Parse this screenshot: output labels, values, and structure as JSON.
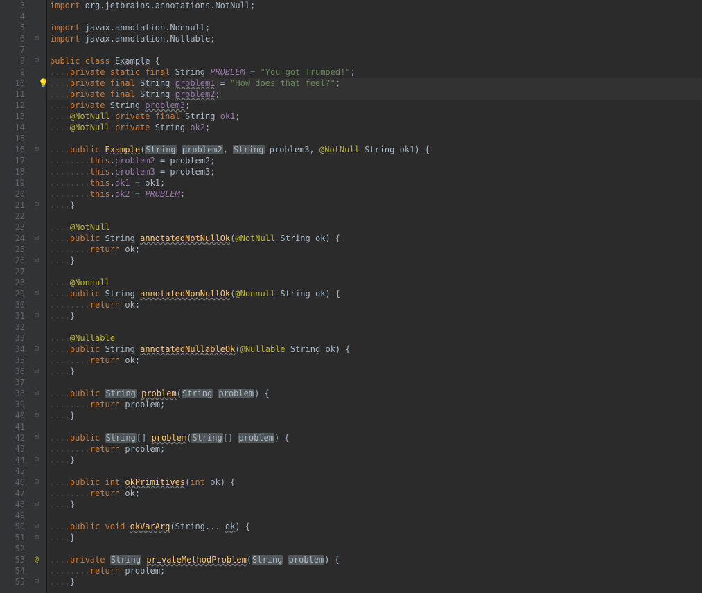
{
  "lines": [
    {
      "n": 3,
      "icon": "",
      "code": [
        [
          "kw",
          "import"
        ],
        [
          "",
          " "
        ],
        [
          "pkg",
          "org.jetbrains.annotations."
        ],
        [
          "cls",
          "NotNull"
        ],
        [
          "",
          ";"
        ]
      ]
    },
    {
      "n": 4,
      "icon": "",
      "code": []
    },
    {
      "n": 5,
      "icon": "",
      "code": [
        [
          "kw",
          "import"
        ],
        [
          "",
          " "
        ],
        [
          "pkg",
          "javax.annotation."
        ],
        [
          "cls",
          "Nonnull"
        ],
        [
          "",
          ";"
        ]
      ]
    },
    {
      "n": 6,
      "icon": "⊟",
      "code": [
        [
          "kw",
          "import"
        ],
        [
          "",
          " "
        ],
        [
          "pkg",
          "javax.annotation."
        ],
        [
          "cls",
          "Nullable"
        ],
        [
          "",
          ";"
        ]
      ]
    },
    {
      "n": 7,
      "icon": "",
      "code": []
    },
    {
      "n": 8,
      "icon": "⊟",
      "code": [
        [
          "kw",
          "public class"
        ],
        [
          "",
          " "
        ],
        [
          "underline",
          "Example"
        ],
        [
          "",
          " {"
        ]
      ]
    },
    {
      "n": 9,
      "icon": "",
      "indent": 1,
      "code": [
        [
          "kw",
          "private static final"
        ],
        [
          "",
          " "
        ],
        [
          "cls",
          "String"
        ],
        [
          "",
          " "
        ],
        [
          "const",
          "PROBLEM"
        ],
        [
          "",
          " = "
        ],
        [
          "str",
          "\"You got Trumped!\""
        ],
        [
          "",
          ";"
        ]
      ]
    },
    {
      "n": 10,
      "icon": "bulb",
      "indent": 1,
      "hl": true,
      "code": [
        [
          "kw",
          "private final"
        ],
        [
          "",
          " "
        ],
        [
          "cls",
          "String"
        ],
        [
          "",
          " "
        ],
        [
          "mbr underline-squig",
          "problem1"
        ],
        [
          "",
          " = "
        ],
        [
          "str",
          "\"How does that feel?\""
        ],
        [
          "",
          ";"
        ]
      ]
    },
    {
      "n": 11,
      "icon": "",
      "indent": 1,
      "hl": true,
      "code": [
        [
          "kw",
          "private final"
        ],
        [
          "",
          " "
        ],
        [
          "cls",
          "String"
        ],
        [
          "",
          " "
        ],
        [
          "mbr underline-squig",
          "problem2"
        ],
        [
          "",
          ";"
        ]
      ]
    },
    {
      "n": 12,
      "icon": "",
      "indent": 1,
      "code": [
        [
          "kw",
          "private"
        ],
        [
          "",
          " "
        ],
        [
          "cls",
          "String"
        ],
        [
          "",
          " "
        ],
        [
          "mbr underline-squig",
          "problem3"
        ],
        [
          "",
          ";"
        ]
      ]
    },
    {
      "n": 13,
      "icon": "",
      "indent": 1,
      "code": [
        [
          "ann",
          "@NotNull"
        ],
        [
          "",
          " "
        ],
        [
          "kw",
          "private final"
        ],
        [
          "",
          " "
        ],
        [
          "cls",
          "String"
        ],
        [
          "",
          " "
        ],
        [
          "mbr",
          "ok1"
        ],
        [
          "",
          ";"
        ]
      ]
    },
    {
      "n": 14,
      "icon": "",
      "indent": 1,
      "code": [
        [
          "ann",
          "@NotNull"
        ],
        [
          "",
          " "
        ],
        [
          "kw",
          "private"
        ],
        [
          "",
          " "
        ],
        [
          "cls",
          "String"
        ],
        [
          "",
          " "
        ],
        [
          "mbr",
          "ok2"
        ],
        [
          "",
          ";"
        ]
      ]
    },
    {
      "n": 15,
      "icon": "",
      "code": []
    },
    {
      "n": 16,
      "icon": "⊟",
      "indent": 1,
      "code": [
        [
          "kw",
          "public"
        ],
        [
          "",
          " "
        ],
        [
          "meth underline",
          "Example"
        ],
        [
          "",
          "("
        ],
        [
          "cls box",
          "String"
        ],
        [
          "",
          " "
        ],
        [
          "param box",
          "problem2"
        ],
        [
          "",
          ", "
        ],
        [
          "cls box",
          "String"
        ],
        [
          "",
          " "
        ],
        [
          "param",
          "problem3"
        ],
        [
          "",
          ", "
        ],
        [
          "ann",
          "@NotNull"
        ],
        [
          "",
          " "
        ],
        [
          "cls",
          "String"
        ],
        [
          "",
          " "
        ],
        [
          "param",
          "ok1"
        ],
        [
          "",
          ") {"
        ]
      ]
    },
    {
      "n": 17,
      "icon": "",
      "indent": 2,
      "code": [
        [
          "kw",
          "this"
        ],
        [
          "",
          "."
        ],
        [
          "mbr",
          "problem2"
        ],
        [
          "",
          " = problem2;"
        ]
      ]
    },
    {
      "n": 18,
      "icon": "",
      "indent": 2,
      "code": [
        [
          "kw",
          "this"
        ],
        [
          "",
          "."
        ],
        [
          "mbr",
          "problem3"
        ],
        [
          "",
          " = problem3;"
        ]
      ]
    },
    {
      "n": 19,
      "icon": "",
      "indent": 2,
      "code": [
        [
          "kw",
          "this"
        ],
        [
          "",
          "."
        ],
        [
          "mbr",
          "ok1"
        ],
        [
          "",
          " = ok1;"
        ]
      ]
    },
    {
      "n": 20,
      "icon": "",
      "indent": 2,
      "code": [
        [
          "kw",
          "this"
        ],
        [
          "",
          "."
        ],
        [
          "mbr",
          "ok2"
        ],
        [
          "",
          " = "
        ],
        [
          "const",
          "PROBLEM"
        ],
        [
          "",
          ";"
        ]
      ]
    },
    {
      "n": 21,
      "icon": "⊟",
      "indent": 1,
      "closer": true,
      "code": [
        [
          "",
          "}"
        ]
      ]
    },
    {
      "n": 22,
      "icon": "",
      "code": []
    },
    {
      "n": 23,
      "icon": "",
      "indent": 1,
      "code": [
        [
          "ann",
          "@NotNull"
        ]
      ]
    },
    {
      "n": 24,
      "icon": "⊟",
      "indent": 1,
      "code": [
        [
          "kw",
          "public"
        ],
        [
          "",
          " "
        ],
        [
          "cls",
          "String"
        ],
        [
          "",
          " "
        ],
        [
          "meth underline-squig",
          "annotatedNotNullOk"
        ],
        [
          "",
          "("
        ],
        [
          "ann",
          "@NotNull"
        ],
        [
          "",
          " "
        ],
        [
          "cls",
          "String"
        ],
        [
          "",
          " "
        ],
        [
          "param",
          "ok"
        ],
        [
          "",
          ") {"
        ]
      ]
    },
    {
      "n": 25,
      "icon": "",
      "indent": 2,
      "code": [
        [
          "kw",
          "return"
        ],
        [
          "",
          " ok;"
        ]
      ]
    },
    {
      "n": 26,
      "icon": "⊟",
      "indent": 1,
      "closer": true,
      "code": [
        [
          "",
          "}"
        ]
      ]
    },
    {
      "n": 27,
      "icon": "",
      "code": []
    },
    {
      "n": 28,
      "icon": "",
      "indent": 1,
      "code": [
        [
          "ann",
          "@Nonnull"
        ]
      ]
    },
    {
      "n": 29,
      "icon": "⊟",
      "indent": 1,
      "code": [
        [
          "kw",
          "public"
        ],
        [
          "",
          " "
        ],
        [
          "cls",
          "String"
        ],
        [
          "",
          " "
        ],
        [
          "meth underline-squig",
          "annotatedNonNullOk"
        ],
        [
          "",
          "("
        ],
        [
          "ann",
          "@Nonnull"
        ],
        [
          "",
          " "
        ],
        [
          "cls",
          "String"
        ],
        [
          "",
          " "
        ],
        [
          "param",
          "ok"
        ],
        [
          "",
          ") {"
        ]
      ]
    },
    {
      "n": 30,
      "icon": "",
      "indent": 2,
      "code": [
        [
          "kw",
          "return"
        ],
        [
          "",
          " ok;"
        ]
      ]
    },
    {
      "n": 31,
      "icon": "⊟",
      "indent": 1,
      "closer": true,
      "code": [
        [
          "",
          "}"
        ]
      ]
    },
    {
      "n": 32,
      "icon": "",
      "code": []
    },
    {
      "n": 33,
      "icon": "",
      "indent": 1,
      "code": [
        [
          "ann",
          "@Nullable"
        ]
      ]
    },
    {
      "n": 34,
      "icon": "⊟",
      "indent": 1,
      "code": [
        [
          "kw",
          "public"
        ],
        [
          "",
          " "
        ],
        [
          "cls",
          "String"
        ],
        [
          "",
          " "
        ],
        [
          "meth underline-squig",
          "annotatedNullableOk"
        ],
        [
          "",
          "("
        ],
        [
          "ann",
          "@Nullable"
        ],
        [
          "",
          " "
        ],
        [
          "cls",
          "String"
        ],
        [
          "",
          " "
        ],
        [
          "param",
          "ok"
        ],
        [
          "",
          ") {"
        ]
      ]
    },
    {
      "n": 35,
      "icon": "",
      "indent": 2,
      "code": [
        [
          "kw",
          "return"
        ],
        [
          "",
          " ok;"
        ]
      ]
    },
    {
      "n": 36,
      "icon": "⊟",
      "indent": 1,
      "closer": true,
      "code": [
        [
          "",
          "}"
        ]
      ]
    },
    {
      "n": 37,
      "icon": "",
      "code": []
    },
    {
      "n": 38,
      "icon": "⊟",
      "indent": 1,
      "code": [
        [
          "kw",
          "public"
        ],
        [
          "",
          " "
        ],
        [
          "cls box",
          "String"
        ],
        [
          "",
          " "
        ],
        [
          "meth underline-squig",
          "problem"
        ],
        [
          "",
          "("
        ],
        [
          "cls box",
          "String"
        ],
        [
          "",
          " "
        ],
        [
          "param box",
          "problem"
        ],
        [
          "",
          ") {"
        ]
      ]
    },
    {
      "n": 39,
      "icon": "",
      "indent": 2,
      "code": [
        [
          "kw",
          "return"
        ],
        [
          "",
          " problem;"
        ]
      ]
    },
    {
      "n": 40,
      "icon": "⊟",
      "indent": 1,
      "closer": true,
      "code": [
        [
          "",
          "}"
        ]
      ]
    },
    {
      "n": 41,
      "icon": "",
      "code": []
    },
    {
      "n": 42,
      "icon": "⊟",
      "indent": 1,
      "code": [
        [
          "kw",
          "public"
        ],
        [
          "",
          " "
        ],
        [
          "cls box",
          "String"
        ],
        [
          "",
          "[] "
        ],
        [
          "meth underline-squig",
          "problem"
        ],
        [
          "",
          "("
        ],
        [
          "cls box",
          "String"
        ],
        [
          "",
          "[] "
        ],
        [
          "param box",
          "problem"
        ],
        [
          "",
          ") {"
        ]
      ]
    },
    {
      "n": 43,
      "icon": "",
      "indent": 2,
      "code": [
        [
          "kw",
          "return"
        ],
        [
          "",
          " problem;"
        ]
      ]
    },
    {
      "n": 44,
      "icon": "⊟",
      "indent": 1,
      "closer": true,
      "code": [
        [
          "",
          "}"
        ]
      ]
    },
    {
      "n": 45,
      "icon": "",
      "code": []
    },
    {
      "n": 46,
      "icon": "⊟",
      "indent": 1,
      "code": [
        [
          "kw",
          "public int"
        ],
        [
          "",
          " "
        ],
        [
          "meth underline-squig",
          "okPrimitives"
        ],
        [
          "",
          "("
        ],
        [
          "kw",
          "int"
        ],
        [
          "",
          " "
        ],
        [
          "param",
          "ok"
        ],
        [
          "",
          ") {"
        ]
      ]
    },
    {
      "n": 47,
      "icon": "",
      "indent": 2,
      "code": [
        [
          "kw",
          "return"
        ],
        [
          "",
          " ok;"
        ]
      ]
    },
    {
      "n": 48,
      "icon": "⊟",
      "indent": 1,
      "closer": true,
      "code": [
        [
          "",
          "}"
        ]
      ]
    },
    {
      "n": 49,
      "icon": "",
      "code": []
    },
    {
      "n": 50,
      "icon": "⊟",
      "indent": 1,
      "code": [
        [
          "kw",
          "public void"
        ],
        [
          "",
          " "
        ],
        [
          "meth underline-squig",
          "okVarArg"
        ],
        [
          "",
          "("
        ],
        [
          "cls",
          "String"
        ],
        [
          "",
          "... "
        ],
        [
          "param underline-squig",
          "ok"
        ],
        [
          "",
          ") {"
        ]
      ]
    },
    {
      "n": 51,
      "icon": "⊟",
      "indent": 1,
      "closer": true,
      "code": [
        [
          "",
          "}"
        ]
      ]
    },
    {
      "n": 52,
      "icon": "",
      "code": []
    },
    {
      "n": 53,
      "icon": "@",
      "indent": 1,
      "code": [
        [
          "kw",
          "private"
        ],
        [
          "",
          " "
        ],
        [
          "cls box",
          "String"
        ],
        [
          "",
          " "
        ],
        [
          "meth underline-squig",
          "privateMethodProblem"
        ],
        [
          "",
          "("
        ],
        [
          "cls box",
          "String"
        ],
        [
          "",
          " "
        ],
        [
          "param box",
          "problem"
        ],
        [
          "",
          ") {"
        ]
      ]
    },
    {
      "n": 54,
      "icon": "",
      "indent": 2,
      "code": [
        [
          "kw",
          "return"
        ],
        [
          "",
          " problem;"
        ]
      ]
    },
    {
      "n": 55,
      "icon": "⊟",
      "indent": 1,
      "closer": true,
      "code": [
        [
          "",
          "}"
        ]
      ]
    }
  ]
}
